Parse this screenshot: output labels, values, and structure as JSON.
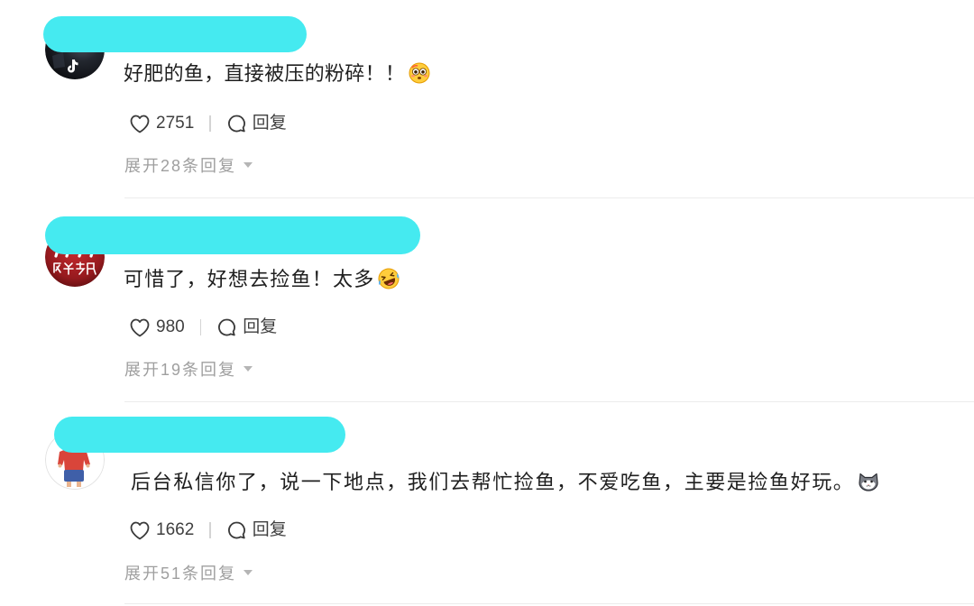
{
  "redaction_color": "#45eaf0",
  "icons": {
    "like": "heart-outline-icon",
    "reply": "comment-bubble-icon",
    "expand": "caret-down-icon"
  },
  "comments": [
    {
      "text": "好肥的鱼，直接被压的粉碎！！",
      "emoji": "flushed-face-emoji-icon",
      "likes": "2751",
      "reply_label": "回复",
      "expand_label": "展开28条回复"
    },
    {
      "text": "可惜了，好想去捡鱼！太多",
      "emoji": "rolling-laughing-emoji-icon",
      "likes": "980",
      "reply_label": "回复",
      "expand_label": "展开19条回复"
    },
    {
      "text": "后台私信你了，说一下地点，我们去帮忙捡鱼，不爱吃鱼，主要是捡鱼好玩。",
      "emoji": "cat-face-emoji-icon",
      "likes": "1662",
      "reply_label": "回复",
      "expand_label": "展开51条回复"
    }
  ]
}
